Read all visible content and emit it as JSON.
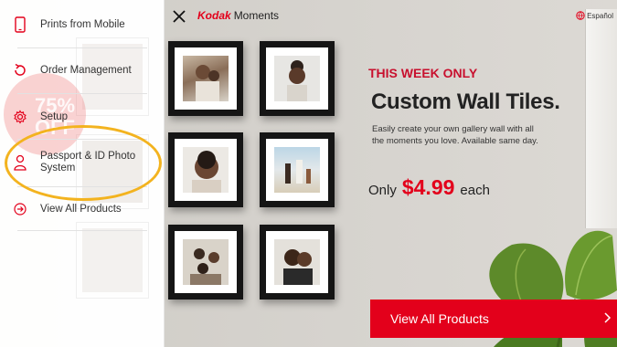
{
  "header": {
    "brand_kodak": "Kodak",
    "brand_moments": "Moments",
    "language_label": "Español"
  },
  "sidebar": {
    "items": [
      {
        "label": "Prints from Mobile",
        "icon": "phone-icon"
      },
      {
        "label": "Order Management",
        "icon": "refresh-icon"
      },
      {
        "label": "Setup",
        "icon": "gear-icon"
      },
      {
        "label": "Passport & ID Photo System",
        "icon": "person-icon"
      },
      {
        "label": "View All Products",
        "icon": "arrow-circle-icon"
      }
    ],
    "promo_text": "75% OFF"
  },
  "promo": {
    "tag": "THIS WEEK ONLY",
    "headline": "Custom Wall Tiles.",
    "description": "Easily create your own gallery wall with all the moments you love. Available same day.",
    "price_prefix": "Only",
    "price": "$4.99",
    "price_suffix": "each",
    "cta_label": "View All Products"
  },
  "colors": {
    "accent": "#e3001b",
    "tag_red": "#c8102e",
    "highlight": "#f3b31f"
  }
}
